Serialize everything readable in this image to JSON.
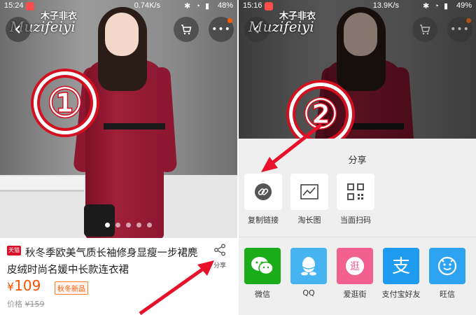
{
  "left_screen": {
    "status": {
      "time": "15:24",
      "speed": "0.74K/s",
      "battery": "48%"
    },
    "brand": {
      "cn": "木子非衣",
      "en": "Muzifeiyi"
    },
    "step_number": "①",
    "carousel": {
      "count": 5,
      "active": 1
    },
    "product": {
      "platform_badge": "天猫",
      "title": "秋冬季欧美气质长袖修身显瘦一步裙麂皮绒时尚名媛中长款连衣裙",
      "currency": "¥",
      "price": "109",
      "tag": "秋冬新品",
      "orig_label": "价格",
      "orig_price": "¥159",
      "share_label": "分享"
    }
  },
  "right_screen": {
    "status": {
      "time": "15:16",
      "speed": "13.9K/s",
      "battery": "49%"
    },
    "brand": {
      "cn": "木子非衣",
      "en": "Muzifeiyi"
    },
    "step_number": "②",
    "share_sheet": {
      "title": "分享",
      "tools": [
        {
          "label": "复制链接",
          "icon": "link-icon"
        },
        {
          "label": "淘长图",
          "icon": "image-chart-icon"
        },
        {
          "label": "当面扫码",
          "icon": "qr-code-icon"
        }
      ],
      "apps": [
        {
          "label": "微信",
          "icon": "wechat-icon",
          "color": "#1aad19"
        },
        {
          "label": "QQ",
          "icon": "qq-icon",
          "color": "#45b4f0"
        },
        {
          "label": "爱逛街",
          "icon": "guang-icon",
          "color": "#f2608f"
        },
        {
          "label": "支付宝好友",
          "icon": "alipay-icon",
          "color": "#1f9cf0"
        },
        {
          "label": "旺信",
          "icon": "wangxin-icon",
          "color": "#2ea3f2"
        }
      ]
    }
  },
  "colors": {
    "arrow": "#e8102a",
    "price": "#ff4f00"
  }
}
